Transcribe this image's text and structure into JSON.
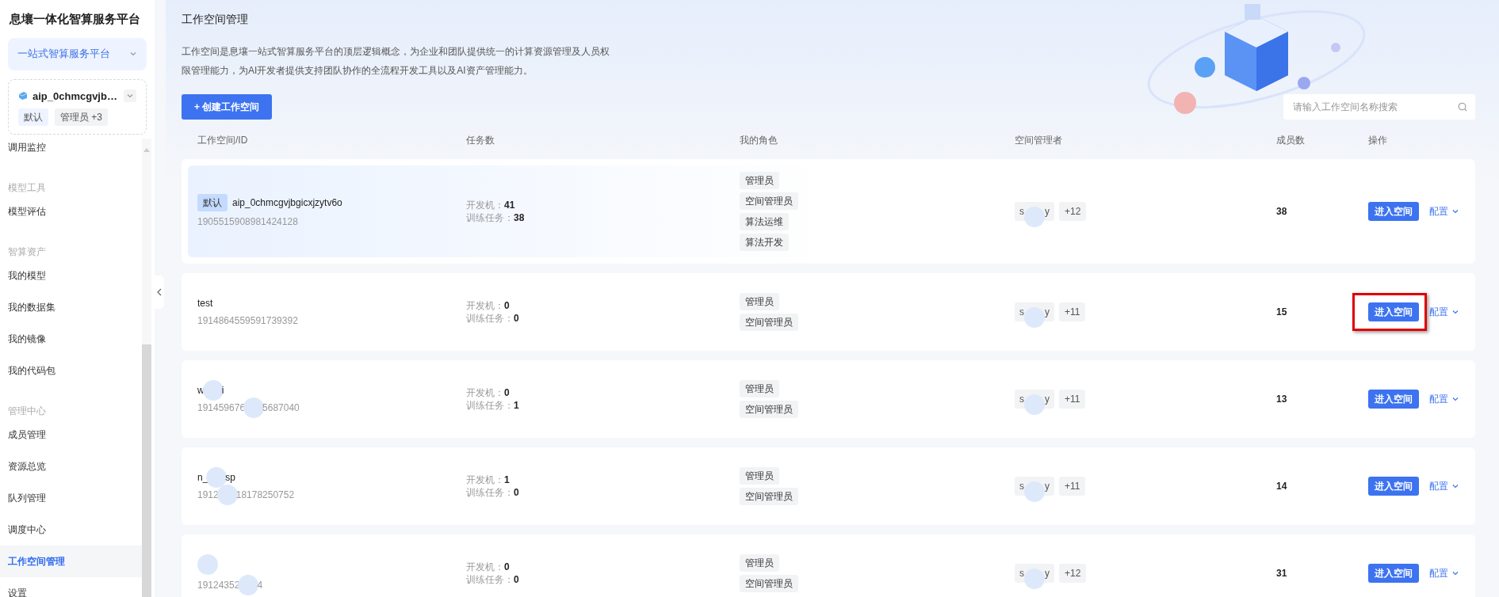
{
  "sidebar": {
    "title": "息壤一体化智算服务平台",
    "platform_select": {
      "value": "一站式智算服务平台"
    },
    "workspace": {
      "name": "aip_0chmcgvjb…",
      "tags": [
        "默认",
        "管理员 +3"
      ]
    },
    "groups": [
      {
        "items": [
          {
            "label": "调用监控",
            "selected": false
          }
        ]
      },
      {
        "heading": "模型工具",
        "items": [
          {
            "label": "模型评估",
            "selected": false
          }
        ]
      },
      {
        "heading": "智算资产",
        "items": [
          {
            "label": "我的模型",
            "selected": false
          },
          {
            "label": "我的数据集",
            "selected": false
          },
          {
            "label": "我的镜像",
            "selected": false
          },
          {
            "label": "我的代码包",
            "selected": false
          }
        ]
      },
      {
        "heading": "管理中心",
        "items": [
          {
            "label": "成员管理",
            "selected": false
          },
          {
            "label": "资源总览",
            "selected": false
          },
          {
            "label": "队列管理",
            "selected": false
          },
          {
            "label": "调度中心",
            "selected": false
          },
          {
            "label": "工作空间管理",
            "selected": true
          },
          {
            "label": "设置",
            "selected": false
          }
        ]
      }
    ]
  },
  "page": {
    "title": "工作空间管理",
    "description": "工作空间是息壤一站式智算服务平台的顶层逻辑概念，为企业和团队提供统一的计算资源管理及人员权限管理能力，为AI开发者提供支持团队协作的全流程开发工具以及AI资产管理能力。",
    "create_button": "+ 创建工作空间",
    "search": {
      "placeholder": "请输入工作空间名称搜索"
    }
  },
  "table": {
    "columns": [
      "工作空间/ID",
      "任务数",
      "我的角色",
      "空间管理者",
      "成员数",
      "操作"
    ],
    "rows": [
      {
        "default": true,
        "tag": "默认",
        "name": [
          "aip_0chmcgvjbgicxjzytv6o"
        ],
        "id": [
          "1905515908981424128"
        ],
        "tasks": [
          {
            "label": "开发机：",
            "value": "41"
          },
          {
            "label": "训练任务：",
            "value": "38"
          }
        ],
        "roles": [
          "管理员",
          "空间管理员",
          "算法运维",
          "算法开发"
        ],
        "manager": [
          "s",
          "y"
        ],
        "manager_extra": "+12",
        "members": "38",
        "enter": "进入空间",
        "config": "配置",
        "highlighted": false
      },
      {
        "default": false,
        "name": [
          "test"
        ],
        "id": [
          "1914864559591739392"
        ],
        "tasks": [
          {
            "label": "开发机：",
            "value": "0"
          },
          {
            "label": "训练任务：",
            "value": "0"
          }
        ],
        "roles": [
          "管理员",
          "空间管理员"
        ],
        "manager": [
          "s",
          "y"
        ],
        "manager_extra": "+11",
        "members": "15",
        "enter": "进入空间",
        "config": "配置",
        "highlighted": true
      },
      {
        "default": false,
        "name": [
          "w",
          "i"
        ],
        "id": [
          "191459676",
          "5687040"
        ],
        "tasks": [
          {
            "label": "开发机：",
            "value": "0"
          },
          {
            "label": "训练任务：",
            "value": "1"
          }
        ],
        "roles": [
          "管理员",
          "空间管理员"
        ],
        "manager": [
          "s",
          "y"
        ],
        "manager_extra": "+11",
        "members": "13",
        "enter": "进入空间",
        "config": "配置",
        "highlighted": false
      },
      {
        "default": false,
        "name": [
          "n_",
          "sp"
        ],
        "id": [
          "1912",
          "18178250752"
        ],
        "tasks": [
          {
            "label": "开发机：",
            "value": "1"
          },
          {
            "label": "训练任务：",
            "value": "0"
          }
        ],
        "roles": [
          "管理员",
          "空间管理员"
        ],
        "manager": [
          "s",
          "y"
        ],
        "manager_extra": "+11",
        "members": "14",
        "enter": "进入空间",
        "config": "配置",
        "highlighted": false
      },
      {
        "default": false,
        "id": [
          "19124352",
          "4"
        ],
        "tasks": [
          {
            "label": "开发机：",
            "value": "0"
          },
          {
            "label": "训练任务：",
            "value": "0"
          }
        ],
        "roles": [
          "管理员",
          "空间管理员"
        ],
        "manager": [
          "s",
          "y"
        ],
        "manager_extra": "+12",
        "members": "31",
        "enter": "进入空间",
        "config": "配置",
        "highlighted": false
      }
    ]
  }
}
